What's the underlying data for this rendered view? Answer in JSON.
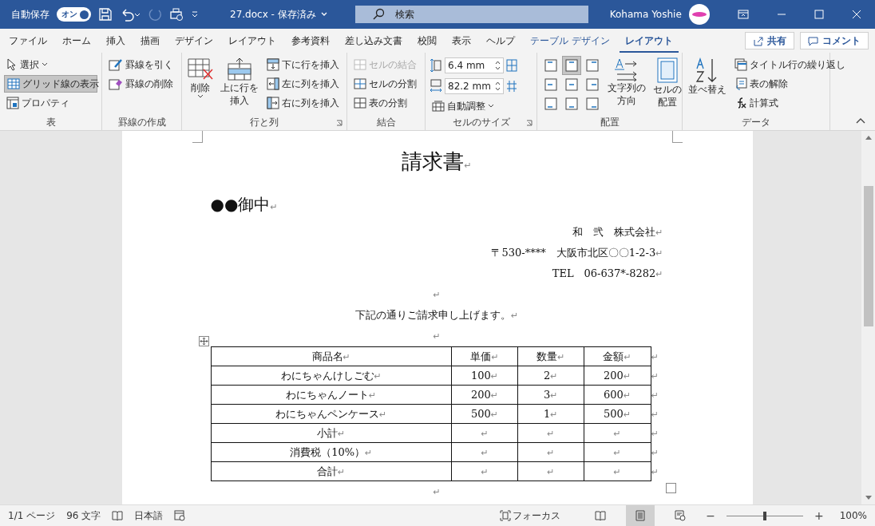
{
  "title_bar": {
    "autosave_label": "自動保存",
    "autosave": {
      "label": "オン",
      "on": true
    },
    "document_title": "27.docx - 保存済み",
    "search": {
      "placeholder": "検索"
    },
    "user_name": "Kohama Yoshie"
  },
  "menu_tabs": [
    {
      "label": "ファイル",
      "kind": "normal",
      "selected": false
    },
    {
      "label": "ホーム",
      "kind": "normal",
      "selected": false
    },
    {
      "label": "挿入",
      "kind": "normal",
      "selected": false
    },
    {
      "label": "描画",
      "kind": "normal",
      "selected": false
    },
    {
      "label": "デザイン",
      "kind": "normal",
      "selected": false
    },
    {
      "label": "レイアウト",
      "kind": "normal",
      "selected": false
    },
    {
      "label": "参考資料",
      "kind": "normal",
      "selected": false
    },
    {
      "label": "差し込み文書",
      "kind": "normal",
      "selected": false
    },
    {
      "label": "校閲",
      "kind": "normal",
      "selected": false
    },
    {
      "label": "表示",
      "kind": "normal",
      "selected": false
    },
    {
      "label": "ヘルプ",
      "kind": "normal",
      "selected": false
    },
    {
      "label": "テーブル デザイン",
      "kind": "contextual",
      "selected": false
    },
    {
      "label": "レイアウト",
      "kind": "contextual",
      "selected": true
    }
  ],
  "share_button": "共有",
  "comment_button": "コメント",
  "ribbon": {
    "table": {
      "label": "表",
      "select": "選択",
      "gridlines": {
        "label": "グリッド線の表示",
        "selected": true
      },
      "properties": "プロパティ"
    },
    "draw_borders": {
      "label": "罫線の作成",
      "draw_table": "罫線を引く",
      "eraser": "罫線の削除"
    },
    "rows_columns": {
      "label": "行と列",
      "delete": "削除",
      "insert_above": [
        "上に行を",
        "挿入"
      ],
      "insert_below": "下に行を挿入",
      "insert_left": "左に列を挿入",
      "insert_right": "右に列を挿入"
    },
    "merge": {
      "label": "結合",
      "items": [
        {
          "label": "セルの結合",
          "disabled": true
        },
        {
          "label": "セルの分割",
          "disabled": false
        },
        {
          "label": "表の分割",
          "disabled": false
        }
      ]
    },
    "cell_size": {
      "label": "セルのサイズ",
      "height": "6.4 mm",
      "width": "82.2 mm",
      "autofit": "自動調整"
    },
    "alignment": {
      "label": "配置",
      "cells": [
        {
          "selected": false
        },
        {
          "selected": true
        },
        {
          "selected": false
        },
        {
          "selected": false
        },
        {
          "selected": false
        },
        {
          "selected": false
        },
        {
          "selected": false
        },
        {
          "selected": false
        },
        {
          "selected": false
        }
      ],
      "text_direction": [
        "文字列の",
        "方向"
      ],
      "cell_margins": [
        "セルの",
        "配置"
      ]
    },
    "data": {
      "label": "データ",
      "sort": "並べ替え",
      "repeat_header": "タイトル行の繰り返し",
      "convert": "表の解除",
      "formula": "計算式"
    }
  },
  "document": {
    "title": {
      "text": "請求書",
      "mark": "↵"
    },
    "addressee": {
      "text": "●●御中",
      "mark": "↵"
    },
    "sender": [
      {
        "text": "和　弐　株式会社",
        "mark": "↵"
      },
      {
        "text": "〒530-****　大阪市北区〇〇1-2-3",
        "mark": "↵"
      },
      {
        "text": "TEL　06-637*-8282",
        "mark": "↵"
      }
    ],
    "blank_1": "↵",
    "message": {
      "text": "下記の通りご請求申し上げます。",
      "mark": "↵"
    },
    "blank_2": "↵",
    "table": {
      "rows": [
        {
          "cells": [
            {
              "text": "商品名",
              "mark": "↵"
            },
            {
              "text": "単価",
              "mark": "↵"
            },
            {
              "text": "数量",
              "mark": "↵"
            },
            {
              "text": "金額",
              "mark": "↵"
            }
          ],
          "end_mark": "↵"
        },
        {
          "cells": [
            {
              "text": "わにちゃんけしごむ",
              "mark": "↵"
            },
            {
              "text": "100",
              "mark": "↵"
            },
            {
              "text": "2",
              "mark": "↵"
            },
            {
              "text": "200",
              "mark": "↵"
            }
          ],
          "end_mark": "↵"
        },
        {
          "cells": [
            {
              "text": "わにちゃんノート",
              "mark": "↵"
            },
            {
              "text": "200",
              "mark": "↵"
            },
            {
              "text": "3",
              "mark": "↵"
            },
            {
              "text": "600",
              "mark": "↵"
            }
          ],
          "end_mark": "↵"
        },
        {
          "cells": [
            {
              "text": "わにちゃんペンケース",
              "mark": "↵"
            },
            {
              "text": "500",
              "mark": "↵"
            },
            {
              "text": "1",
              "mark": "↵"
            },
            {
              "text": "500",
              "mark": "↵"
            }
          ],
          "end_mark": "↵"
        },
        {
          "cells": [
            {
              "text": "小計",
              "mark": "↵"
            },
            {
              "mark": "↵"
            },
            {
              "mark": "↵"
            },
            {
              "mark": "↵"
            }
          ],
          "end_mark": "↵"
        },
        {
          "cells": [
            {
              "text": "消費税（10%）",
              "mark": "↵"
            },
            {
              "mark": "↵"
            },
            {
              "mark": "↵"
            },
            {
              "mark": "↵"
            }
          ],
          "end_mark": "↵"
        },
        {
          "cells": [
            {
              "text": "合計",
              "mark": "↵"
            },
            {
              "mark": "↵"
            },
            {
              "mark": "↵"
            },
            {
              "mark": "↵"
            }
          ],
          "end_mark": "↵"
        }
      ]
    },
    "blank_3": "↵"
  },
  "status_bar": {
    "page": "1/1 ページ",
    "words": "96 文字",
    "language": "日本語",
    "focus": "フォーカス",
    "views": [
      {
        "kind": "read",
        "selected": false
      },
      {
        "kind": "print",
        "selected": true
      },
      {
        "kind": "web",
        "selected": false
      }
    ],
    "zoom_out": "−",
    "zoom_in": "+",
    "zoom": {
      "level": 0.5
    },
    "zoom_percent": "100%"
  }
}
